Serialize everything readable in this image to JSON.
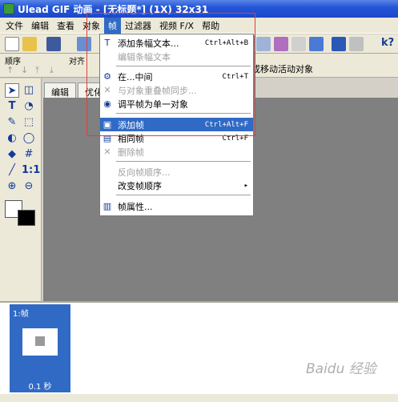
{
  "window": {
    "title": "Ulead GIF 动画 - [无标题*] (1X) 32x31"
  },
  "menubar": {
    "items": [
      "文件",
      "编辑",
      "查看",
      "对象",
      "帧",
      "过滤器",
      "视频 F/X",
      "帮助"
    ],
    "active_index": 4
  },
  "toolbar2": {
    "label_order": "顺序",
    "label_align": "对齐",
    "hint": "或移动活动对象"
  },
  "tabs": [
    "编辑",
    "优化"
  ],
  "dropdown": {
    "items": [
      {
        "label": "添加条幅文本...",
        "shortcut": "Ctrl+Alt+B",
        "icon": "text-banner-icon",
        "disabled": false
      },
      {
        "label": "编辑条幅文本",
        "shortcut": "",
        "icon": "",
        "disabled": true
      },
      {
        "label": "在...中间",
        "shortcut": "Ctrl+T",
        "icon": "tween-icon",
        "disabled": false
      },
      {
        "label": "与对象重叠帧同步...",
        "shortcut": "",
        "icon": "sync-icon",
        "disabled": true
      },
      {
        "label": "调平帧为单一对象",
        "shortcut": "",
        "icon": "flatten-icon",
        "disabled": false
      },
      {
        "label": "添加帧",
        "shortcut": "Ctrl+Alt+F",
        "icon": "add-frame-icon",
        "disabled": false,
        "highlighted": true
      },
      {
        "label": "相同帧",
        "shortcut": "Ctrl+F",
        "icon": "duplicate-frame-icon",
        "disabled": false
      },
      {
        "label": "删除帧",
        "shortcut": "",
        "icon": "delete-frame-icon",
        "disabled": true
      },
      {
        "label": "反向帧顺序...",
        "shortcut": "",
        "icon": "",
        "disabled": true
      },
      {
        "label": "改变帧顺序",
        "shortcut": "",
        "icon": "",
        "disabled": false,
        "submenu": true
      },
      {
        "label": "帧属性...",
        "shortcut": "",
        "icon": "frame-properties-icon",
        "disabled": false
      }
    ]
  },
  "frames": [
    {
      "name": "1:帧",
      "delay": "0.1 秒"
    }
  ],
  "watermark": "Baidu 经验",
  "colors": {
    "highlight": "#316ac5",
    "annotation_box": "#e0403a"
  }
}
